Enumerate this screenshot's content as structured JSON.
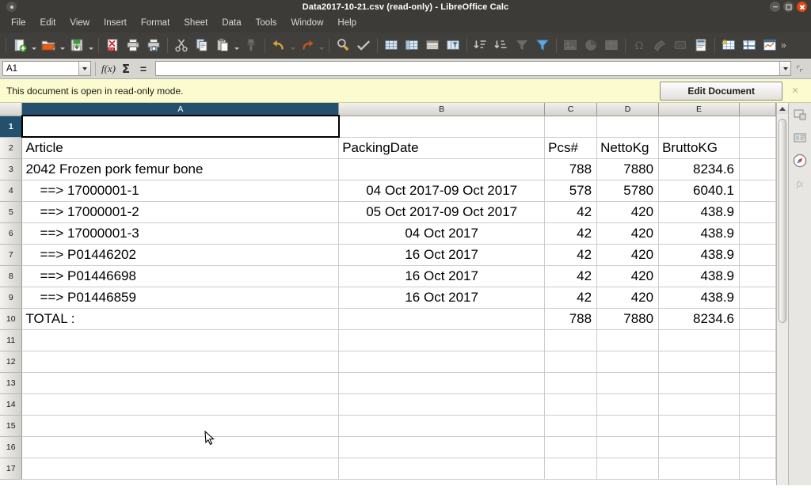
{
  "window": {
    "title": "Data2017-10-21.csv (read-only) - LibreOffice Calc",
    "buttons": {
      "minimize": "minimize",
      "maximize": "maximize",
      "close": "close"
    }
  },
  "menubar": {
    "items": [
      {
        "label": "File"
      },
      {
        "label": "Edit"
      },
      {
        "label": "View"
      },
      {
        "label": "Insert"
      },
      {
        "label": "Format"
      },
      {
        "label": "Sheet"
      },
      {
        "label": "Data"
      },
      {
        "label": "Tools"
      },
      {
        "label": "Window"
      },
      {
        "label": "Help"
      }
    ]
  },
  "toolbar": {
    "overflow_label": "»",
    "items": [
      {
        "name": "new-document-icon"
      },
      {
        "name": "open-document-icon"
      },
      {
        "name": "save-document-icon"
      },
      {
        "name": "export-pdf-icon"
      },
      {
        "name": "print-icon"
      },
      {
        "name": "print-preview-icon"
      },
      {
        "name": "cut-icon"
      },
      {
        "name": "copy-icon"
      },
      {
        "name": "paste-icon"
      },
      {
        "name": "clone-formatting-icon"
      },
      {
        "name": "undo-icon"
      },
      {
        "name": "redo-icon"
      },
      {
        "name": "find-and-replace-icon"
      },
      {
        "name": "spelling-icon"
      },
      {
        "name": "row-icon"
      },
      {
        "name": "column-icon"
      },
      {
        "name": "sort-icon"
      },
      {
        "name": "autofilter-icon"
      },
      {
        "name": "sort-ascending-icon"
      },
      {
        "name": "sort-descending-icon"
      },
      {
        "name": "filter-icon"
      },
      {
        "name": "insert-image-icon"
      },
      {
        "name": "insert-chart-icon"
      },
      {
        "name": "pivot-table-icon"
      },
      {
        "name": "special-character-icon"
      },
      {
        "name": "insert-shape-icon"
      },
      {
        "name": "insert-textbox-icon"
      },
      {
        "name": "headers-and-footers-icon"
      },
      {
        "name": "freeze-rows-columns-icon"
      },
      {
        "name": "split-window-icon"
      },
      {
        "name": "show-draw-functions-icon"
      }
    ]
  },
  "formula_bar": {
    "name_box_value": "A1",
    "function_wizard_label": "f(x)",
    "sum_label": "Σ",
    "formula_label": "=",
    "input_line_value": ""
  },
  "infobar": {
    "message": "This document is open in read-only mode.",
    "edit_button_label": "Edit Document",
    "close_label": "×",
    "background": "#fbfbcf"
  },
  "spreadsheet": {
    "columns": [
      {
        "label": "A",
        "selected": true
      },
      {
        "label": "B",
        "selected": false
      },
      {
        "label": "C",
        "selected": false
      },
      {
        "label": "D",
        "selected": false
      },
      {
        "label": "E",
        "selected": false
      }
    ],
    "selected_cell": "A1",
    "rows": [
      {
        "header": "1",
        "selected": true,
        "cells": [
          "",
          "",
          "",
          "",
          ""
        ]
      },
      {
        "header": "2",
        "selected": false,
        "cells": [
          "Article",
          "PackingDate",
          "Pcs#",
          "NettoKg",
          "BruttoKG"
        ]
      },
      {
        "header": "3",
        "selected": false,
        "cells": [
          "2042 Frozen pork femur bone",
          "",
          "788",
          "7880",
          "8234.6"
        ]
      },
      {
        "header": "4",
        "selected": false,
        "cells": [
          "==> 17000001-1",
          "04 Oct 2017-09 Oct 2017",
          "578",
          "5780",
          "6040.1"
        ]
      },
      {
        "header": "5",
        "selected": false,
        "cells": [
          "==> 17000001-2",
          "05 Oct 2017-09 Oct 2017",
          "42",
          "420",
          "438.9"
        ]
      },
      {
        "header": "6",
        "selected": false,
        "cells": [
          "==> 17000001-3",
          "04 Oct 2017",
          "42",
          "420",
          "438.9"
        ]
      },
      {
        "header": "7",
        "selected": false,
        "cells": [
          "==> P01446202",
          "16 Oct 2017",
          "42",
          "420",
          "438.9"
        ]
      },
      {
        "header": "8",
        "selected": false,
        "cells": [
          "==> P01446698",
          "16 Oct 2017",
          "42",
          "420",
          "438.9"
        ]
      },
      {
        "header": "9",
        "selected": false,
        "cells": [
          "==> P01446859",
          "16 Oct 2017",
          "42",
          "420",
          "438.9"
        ]
      },
      {
        "header": "10",
        "selected": false,
        "cells": [
          "TOTAL :",
          "",
          "788",
          "7880",
          "8234.6"
        ]
      },
      {
        "header": "11",
        "selected": false,
        "cells": [
          "",
          "",
          "",
          "",
          ""
        ]
      },
      {
        "header": "12",
        "selected": false,
        "cells": [
          "",
          "",
          "",
          "",
          ""
        ]
      },
      {
        "header": "13",
        "selected": false,
        "cells": [
          "",
          "",
          "",
          "",
          ""
        ]
      },
      {
        "header": "14",
        "selected": false,
        "cells": [
          "",
          "",
          "",
          "",
          ""
        ]
      },
      {
        "header": "15",
        "selected": false,
        "cells": [
          "",
          "",
          "",
          "",
          ""
        ]
      },
      {
        "header": "16",
        "selected": false,
        "cells": [
          "",
          "",
          "",
          "",
          ""
        ]
      },
      {
        "header": "17",
        "selected": false,
        "cells": [
          "",
          "",
          "",
          "",
          ""
        ]
      }
    ]
  },
  "sidebar": {
    "items": [
      {
        "name": "sidebar-settings-icon"
      },
      {
        "name": "sidebar-properties-icon"
      },
      {
        "name": "sidebar-navigator-icon"
      },
      {
        "name": "sidebar-functions-icon"
      }
    ]
  },
  "scrollbar": {
    "up_label": "▲",
    "down_label": "▼"
  }
}
